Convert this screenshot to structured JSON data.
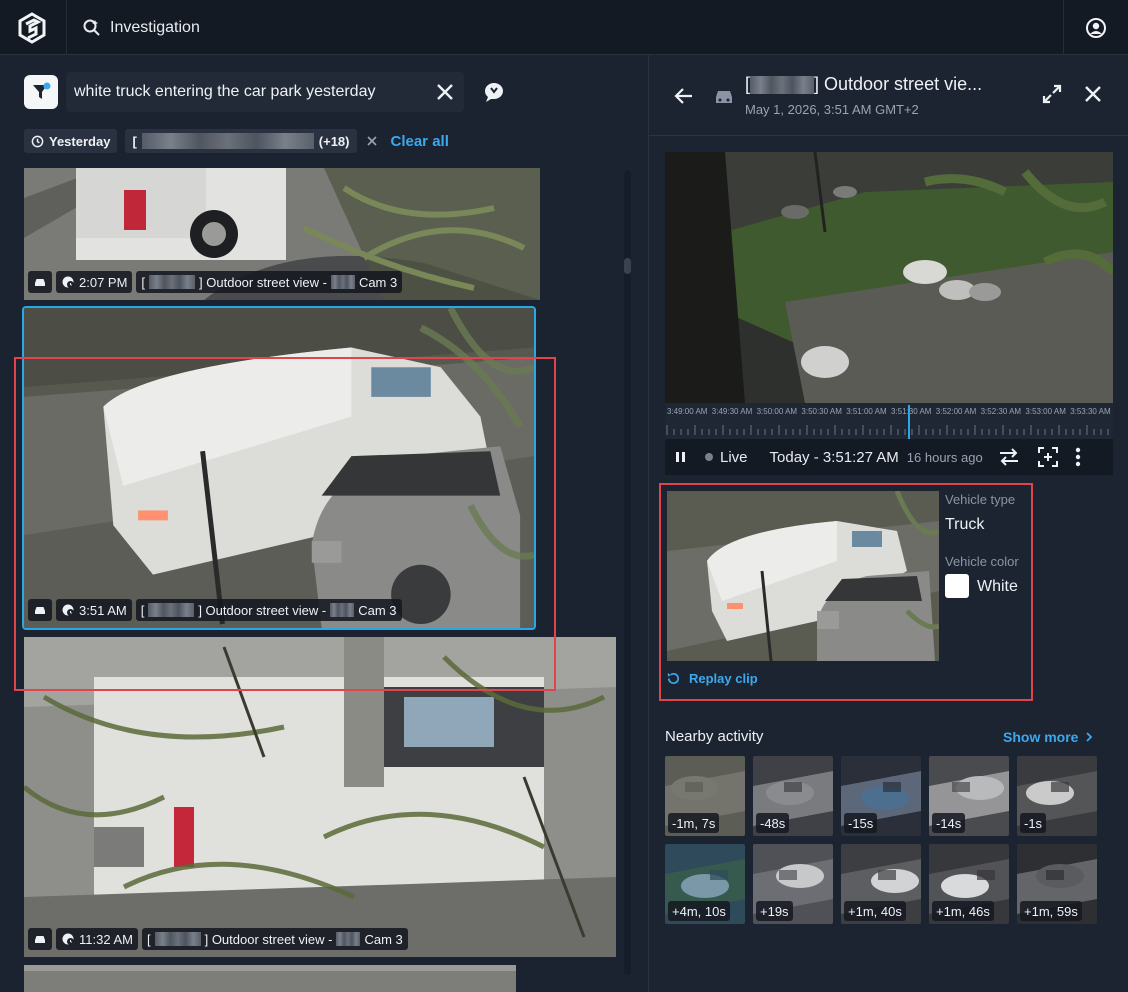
{
  "app": {
    "title": "Investigation"
  },
  "search": {
    "query": "white truck entering the car park yesterday"
  },
  "filters": {
    "date_chip": "Yesterday",
    "camera_chip_count": "(+18)",
    "clear_all": "Clear all"
  },
  "results": [
    {
      "time": "2:07 PM",
      "bracket_open": "[",
      "location": "] Outdoor street view -",
      "cam": "Cam 3"
    },
    {
      "time": "3:51 AM",
      "bracket_open": "[",
      "location": "] Outdoor street view -",
      "cam": "Cam 3"
    },
    {
      "time": "11:32 AM",
      "bracket_open": "[",
      "location": "] Outdoor street view -",
      "cam": "Cam 3"
    }
  ],
  "detail": {
    "bracket_open": "[",
    "title": "] Outdoor street vie...",
    "subtitle": "May 1, 2026, 3:51 AM GMT+2",
    "timeline_labels": [
      "3:49:00 AM",
      "3:49:30 AM",
      "3:50:00 AM",
      "3:50:30 AM",
      "3:51:00 AM",
      "3:51:30 AM",
      "3:52:00 AM",
      "3:52:30 AM",
      "3:53:00 AM",
      "3:53:30 AM"
    ],
    "live_label": "Live",
    "timestamp": "Today - 3:51:27 AM",
    "ago": "16 hours ago",
    "vehicle_type_label": "Vehicle type",
    "vehicle_type": "Truck",
    "vehicle_color_label": "Vehicle color",
    "vehicle_color": "White",
    "replay": "Replay clip"
  },
  "nearby": {
    "title": "Nearby activity",
    "show_more": "Show more",
    "items": [
      "-1m, 7s",
      "-48s",
      "-15s",
      "-14s",
      "-1s",
      "+4m, 10s",
      "+19s",
      "+1m, 40s",
      "+1m, 46s",
      "+1m, 59s"
    ]
  },
  "colors": {
    "accent": "#3aa9ef",
    "highlight": "#e0454b",
    "selected_border": "#2aa8e6"
  }
}
